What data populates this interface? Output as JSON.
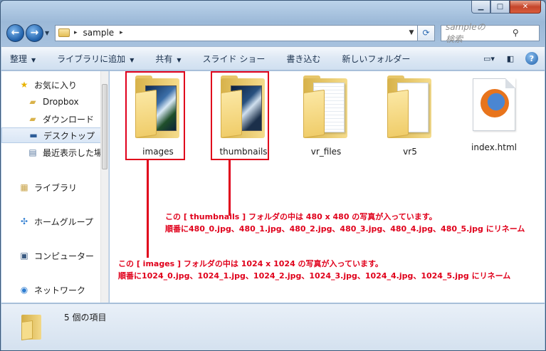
{
  "window": {
    "caption_min": "▁",
    "caption_max": "□",
    "caption_close": "✕"
  },
  "address_bar": {
    "breadcrumb": "sample",
    "search_placeholder": "sampleの検索"
  },
  "toolbar": {
    "organize": "整理",
    "add_to_library": "ライブラリに追加",
    "share": "共有",
    "slideshow": "スライド ショー",
    "burn": "書き込む",
    "new_folder": "新しいフォルダー"
  },
  "sidebar": {
    "items": [
      {
        "label": "お気に入り",
        "icon": "star-icon"
      },
      {
        "label": "Dropbox",
        "icon": "folder-icon"
      },
      {
        "label": "ダウンロード",
        "icon": "download-folder-icon"
      },
      {
        "label": "デスクトップ",
        "icon": "desktop-icon"
      },
      {
        "label": "最近表示した場所",
        "icon": "recent-places-icon"
      },
      {
        "label": "ライブラリ",
        "icon": "library-icon"
      },
      {
        "label": "ホームグループ",
        "icon": "homegroup-icon"
      },
      {
        "label": "コンピューター",
        "icon": "computer-icon"
      },
      {
        "label": "ネットワーク",
        "icon": "network-icon"
      }
    ]
  },
  "files": [
    {
      "name": "images",
      "type": "photo-folder"
    },
    {
      "name": "thumbnails",
      "type": "photo-folder"
    },
    {
      "name": "vr_files",
      "type": "doc-folder"
    },
    {
      "name": "vr5",
      "type": "doc-folder"
    },
    {
      "name": "index.html",
      "type": "firefox-html"
    }
  ],
  "annotations": {
    "thumbnails_line1": "この [ thumbnails ] フォルダの中は 480 x 480 の写真が入っています。",
    "thumbnails_line2": "順番に480_0.jpg、480_1.jpg、480_2.jpg、480_3.jpg、480_4.jpg、480_5.jpg にリネーム",
    "images_line1": "この [ images ] フォルダの中は 1024 x 1024 の写真が入っています。",
    "images_line2": "順番に1024_0.jpg、1024_1.jpg、1024_2.jpg、1024_3.jpg、1024_4.jpg、1024_5.jpg にリネーム",
    "color": "#e0001b"
  },
  "status": {
    "item_count": "5 個の項目"
  }
}
